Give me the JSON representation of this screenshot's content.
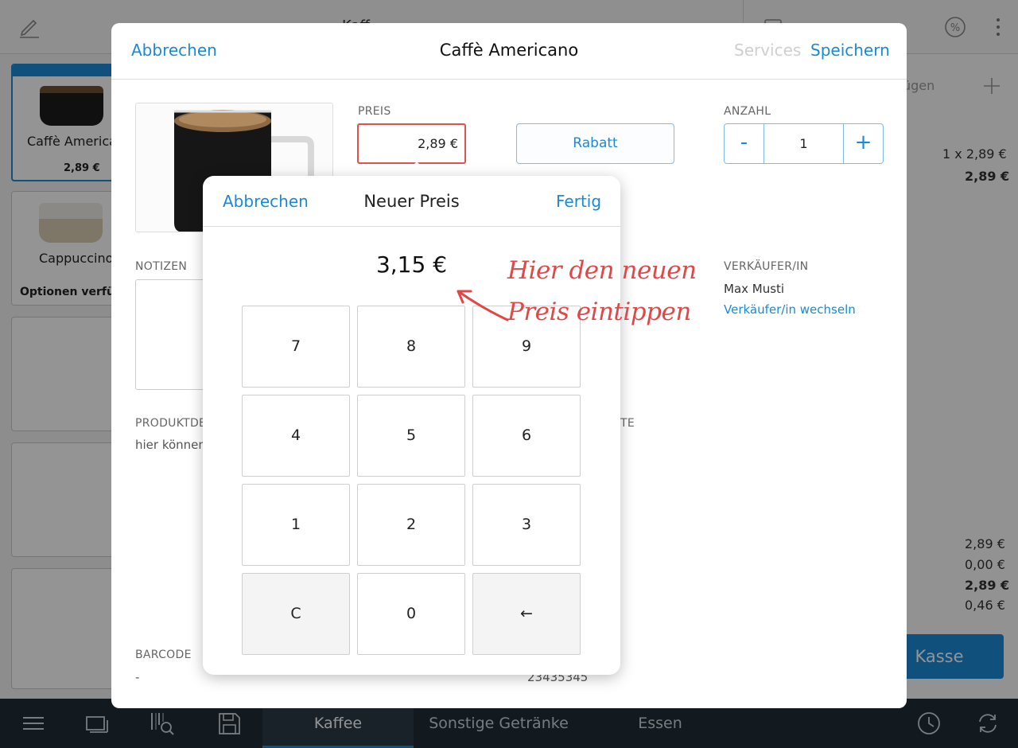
{
  "background": {
    "topbar_title": "Kaff",
    "tiles": [
      {
        "name": "Caffè Americano",
        "price": "2,89 €",
        "selected": true
      },
      {
        "name": "Cappuccino",
        "options": "Optionen verfügbar"
      }
    ],
    "cart": {
      "action_partial": "ügen",
      "line_qty_price": "1 x 2,89 €",
      "line_total": "2,89 €",
      "totals": [
        "2,89 €",
        "0,00 €",
        "2,89 €",
        "0,46 €"
      ],
      "checkout_label": "Kasse"
    },
    "bottom_tabs": [
      {
        "label": "Kaffee",
        "active": true
      },
      {
        "label": "Sonstige Getränke",
        "active": false
      },
      {
        "label": "Essen",
        "active": false
      }
    ]
  },
  "modal": {
    "cancel_label": "Abbrechen",
    "title": "Caffè Americano",
    "services_label": "Services",
    "save_label": "Speichern",
    "price_label": "PREIS",
    "price_value": "2,89 €",
    "discount_label": "Rabatt",
    "quantity_label": "ANZAHL",
    "quantity_value": "1",
    "notes_label": "NOTIZEN",
    "seller_label": "VERKÄUFER/IN",
    "seller_name": "Max Musti",
    "seller_change": "Verkäufer/in wechseln",
    "product_desc_label": "PRODUKTDE",
    "product_desc_text": "hier können",
    "partial_label_te": "TE",
    "barcode_label": "BARCODE",
    "barcode_value": "-",
    "partial_number": "23435345"
  },
  "popover": {
    "cancel_label": "Abbrechen",
    "title": "Neuer Preis",
    "done_label": "Fertig",
    "display_value": "3,15 €",
    "keys": [
      "7",
      "8",
      "9",
      "4",
      "5",
      "6",
      "1",
      "2",
      "3",
      "C",
      "0",
      "←"
    ]
  },
  "annotation": {
    "line1": "Hier den neuen",
    "line2": "Preis eintippen"
  },
  "colors": {
    "accent": "#1a8ad6",
    "annotation": "#e04848",
    "bottom_bar": "#1f2d36"
  }
}
